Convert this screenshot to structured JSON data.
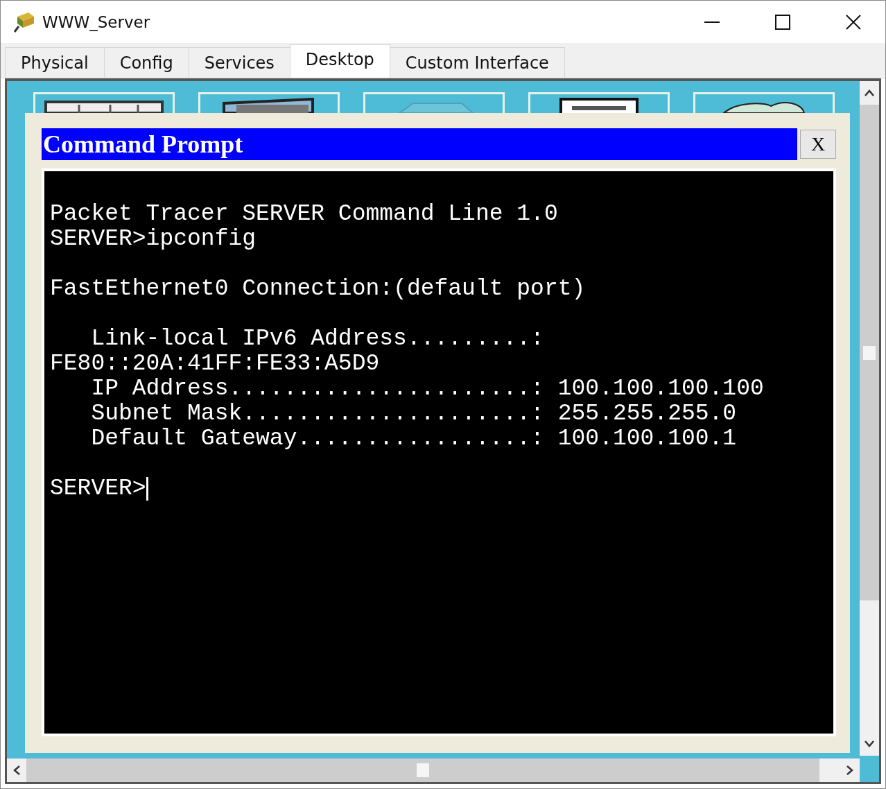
{
  "window": {
    "title": "WWW_Server"
  },
  "tabs": [
    {
      "label": "Physical",
      "selected": false
    },
    {
      "label": "Config",
      "selected": false
    },
    {
      "label": "Services",
      "selected": false
    },
    {
      "label": "Desktop",
      "selected": true
    },
    {
      "label": "Custom Interface",
      "selected": false
    }
  ],
  "command_prompt": {
    "title": "Command Prompt",
    "close_label": "X",
    "blocks": [
      [
        "Packet Tracer SERVER Command Line 1.0",
        "SERVER>ipconfig"
      ],
      [
        "FastEthernet0 Connection:(default port)"
      ],
      [
        "   Link-local IPv6 Address.........:",
        "FE80::20A:41FF:FE33:A5D9",
        "   IP Address......................: 100.100.100.100",
        "   Subnet Mask.....................: 255.255.255.0",
        "   Default Gateway.................: 100.100.100.1"
      ],
      [
        "SERVER>"
      ]
    ]
  }
}
